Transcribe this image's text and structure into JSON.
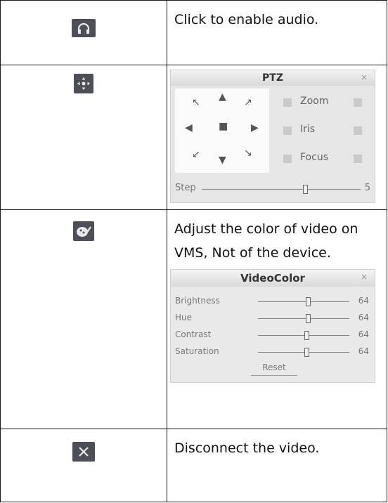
{
  "rows": [
    {
      "icon": "headphones-icon",
      "description": "Click to enable audio."
    },
    {
      "icon": "ptz-move-icon",
      "description": ""
    },
    {
      "icon": "color-palette-icon",
      "description": "Adjust the color of video on VMS, Not of the device."
    },
    {
      "icon": "close-icon",
      "description": "Disconnect the video."
    }
  ],
  "ptz_panel": {
    "title": "PTZ",
    "zoom_label": "Zoom",
    "iris_label": "Iris",
    "focus_label": "Focus",
    "step_label": "Step",
    "step_value": "5"
  },
  "videocolor_panel": {
    "title": "VideoColor",
    "sliders": [
      {
        "label": "Brightness",
        "value": "64"
      },
      {
        "label": "Hue",
        "value": "64"
      },
      {
        "label": "Contrast",
        "value": "64"
      },
      {
        "label": "Saturation",
        "value": "64"
      }
    ],
    "reset_label": "Reset"
  },
  "colors": {
    "icon_bg": "#4d4f58",
    "border": "#1a1a1a"
  }
}
